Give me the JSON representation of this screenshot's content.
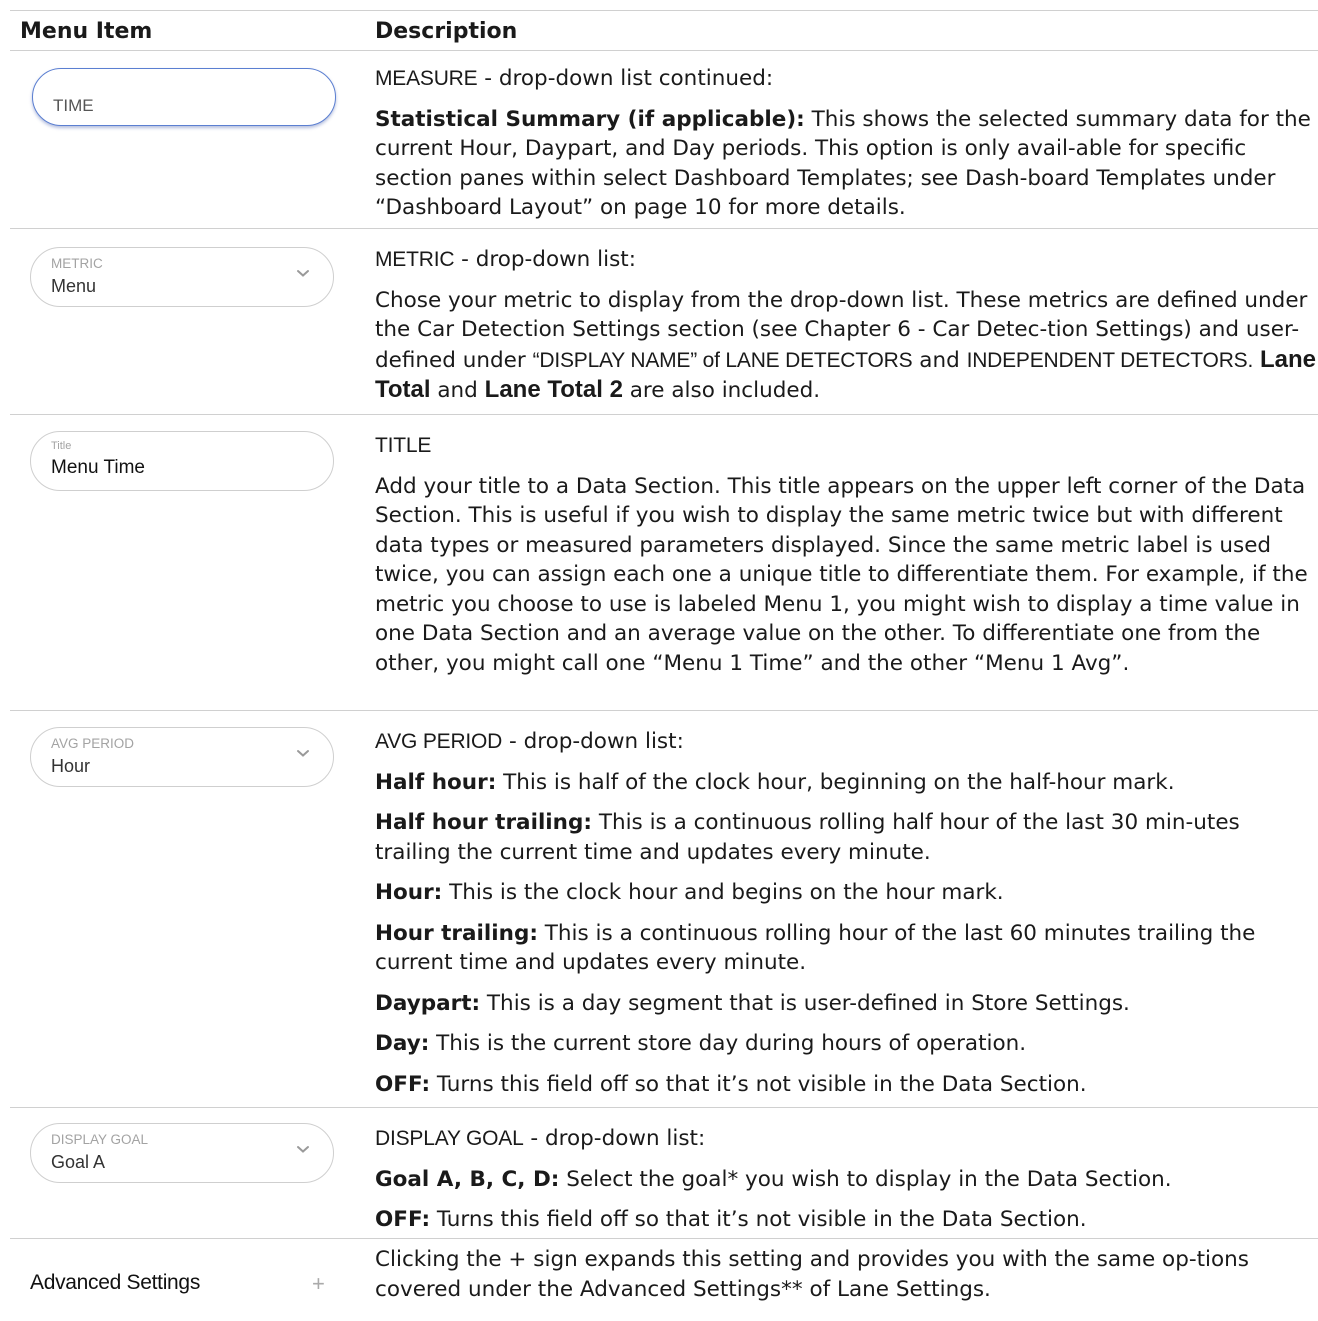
{
  "header": {
    "menu_item": "Menu Item",
    "description": "Description"
  },
  "rows": {
    "time": {
      "field": {
        "value": "TIME"
      },
      "heading": "MEASURE",
      "heading_rest": " - drop-down list continued:",
      "p1_bold": "Statistical Summary (if applicable):",
      "p1_text": " This shows the selected summary data for the current Hour, Daypart, and Day periods. This option is only avail-able for specific section panes within select Dashboard Templates; see Dash-board Templates under “Dashboard Layout” on page 10 for more details."
    },
    "metric": {
      "field": {
        "label": "METRIC",
        "value": "Menu"
      },
      "heading": "METRIC",
      "heading_rest": " - drop-down list:",
      "p1_a": "Chose your metric to display from the drop-down list. These metrics are defined under the Car Detection Settings section (see Chapter 6 - Car Detec-tion Settings) and user-defined under ",
      "p1_cap1": "“DISPLAY NAME” of LANE DETECTORS",
      "p1_b": " and ",
      "p1_cap2": "INDEPENDENT DETECTORS.",
      "p1_c": " ",
      "p1_bold1": "Lane Total",
      "p1_d": " and ",
      "p1_bold2": "Lane Total 2",
      "p1_e": " are also included."
    },
    "title": {
      "field": {
        "label": "Title",
        "value": "Menu Time"
      },
      "heading": "TITLE",
      "p1": "Add your title to a Data Section. This title appears on the upper left corner of the Data Section. This is useful if you wish to display the same metric twice but with different data types or measured parameters displayed. Since the same metric label is used twice, you can assign each one a unique title to differentiate them. For example, if the metric you choose to use is labeled Menu 1, you might wish to display a time value in one Data Section and an average value on the other. To differentiate one from the other, you might call one “Menu 1 Time” and the other “Menu 1 Avg”."
    },
    "avg_period": {
      "field": {
        "label": "AVG PERIOD",
        "value": "Hour"
      },
      "heading": "AVG PERIOD",
      "heading_rest": " - drop-down list:",
      "items": [
        {
          "bold": "Half hour:",
          "text": " This is half of the clock hour, beginning on the half-hour mark."
        },
        {
          "bold": "Half hour trailing:",
          "text": " This is a continuous rolling half hour of the last 30 min-utes trailing the current time and updates every minute."
        },
        {
          "bold": "Hour:",
          "text": " This is the clock hour and begins on the hour mark."
        },
        {
          "bold": "Hour trailing:",
          "text": " This is a continuous rolling hour of the last 60 minutes trailing the current time and updates every minute."
        },
        {
          "bold": "Daypart:",
          "text": " This is a day segment that is user-defined in Store Settings."
        },
        {
          "bold": "Day:",
          "text": " This is the current store day during hours of operation."
        },
        {
          "bold": "OFF:",
          "text": " Turns this field off so that it’s not visible in the Data Section."
        }
      ]
    },
    "display_goal": {
      "field": {
        "label": "DISPLAY GOAL",
        "value": "Goal A"
      },
      "heading": "DISPLAY GOAL",
      "heading_rest": " - drop-down list:",
      "items": [
        {
          "bold": "Goal A, B, C, D:",
          "text": " Select the goal* you wish to display in the Data Section."
        },
        {
          "bold": "OFF:",
          "text": " Turns this field off so that it’s not visible in the Data Section."
        }
      ]
    },
    "advanced": {
      "label": "Advanced Settings",
      "plus": "+",
      "p1": "Clicking the + sign expands this setting and provides you with the same op-tions covered under the Advanced Settings** of Lane Settings."
    }
  }
}
